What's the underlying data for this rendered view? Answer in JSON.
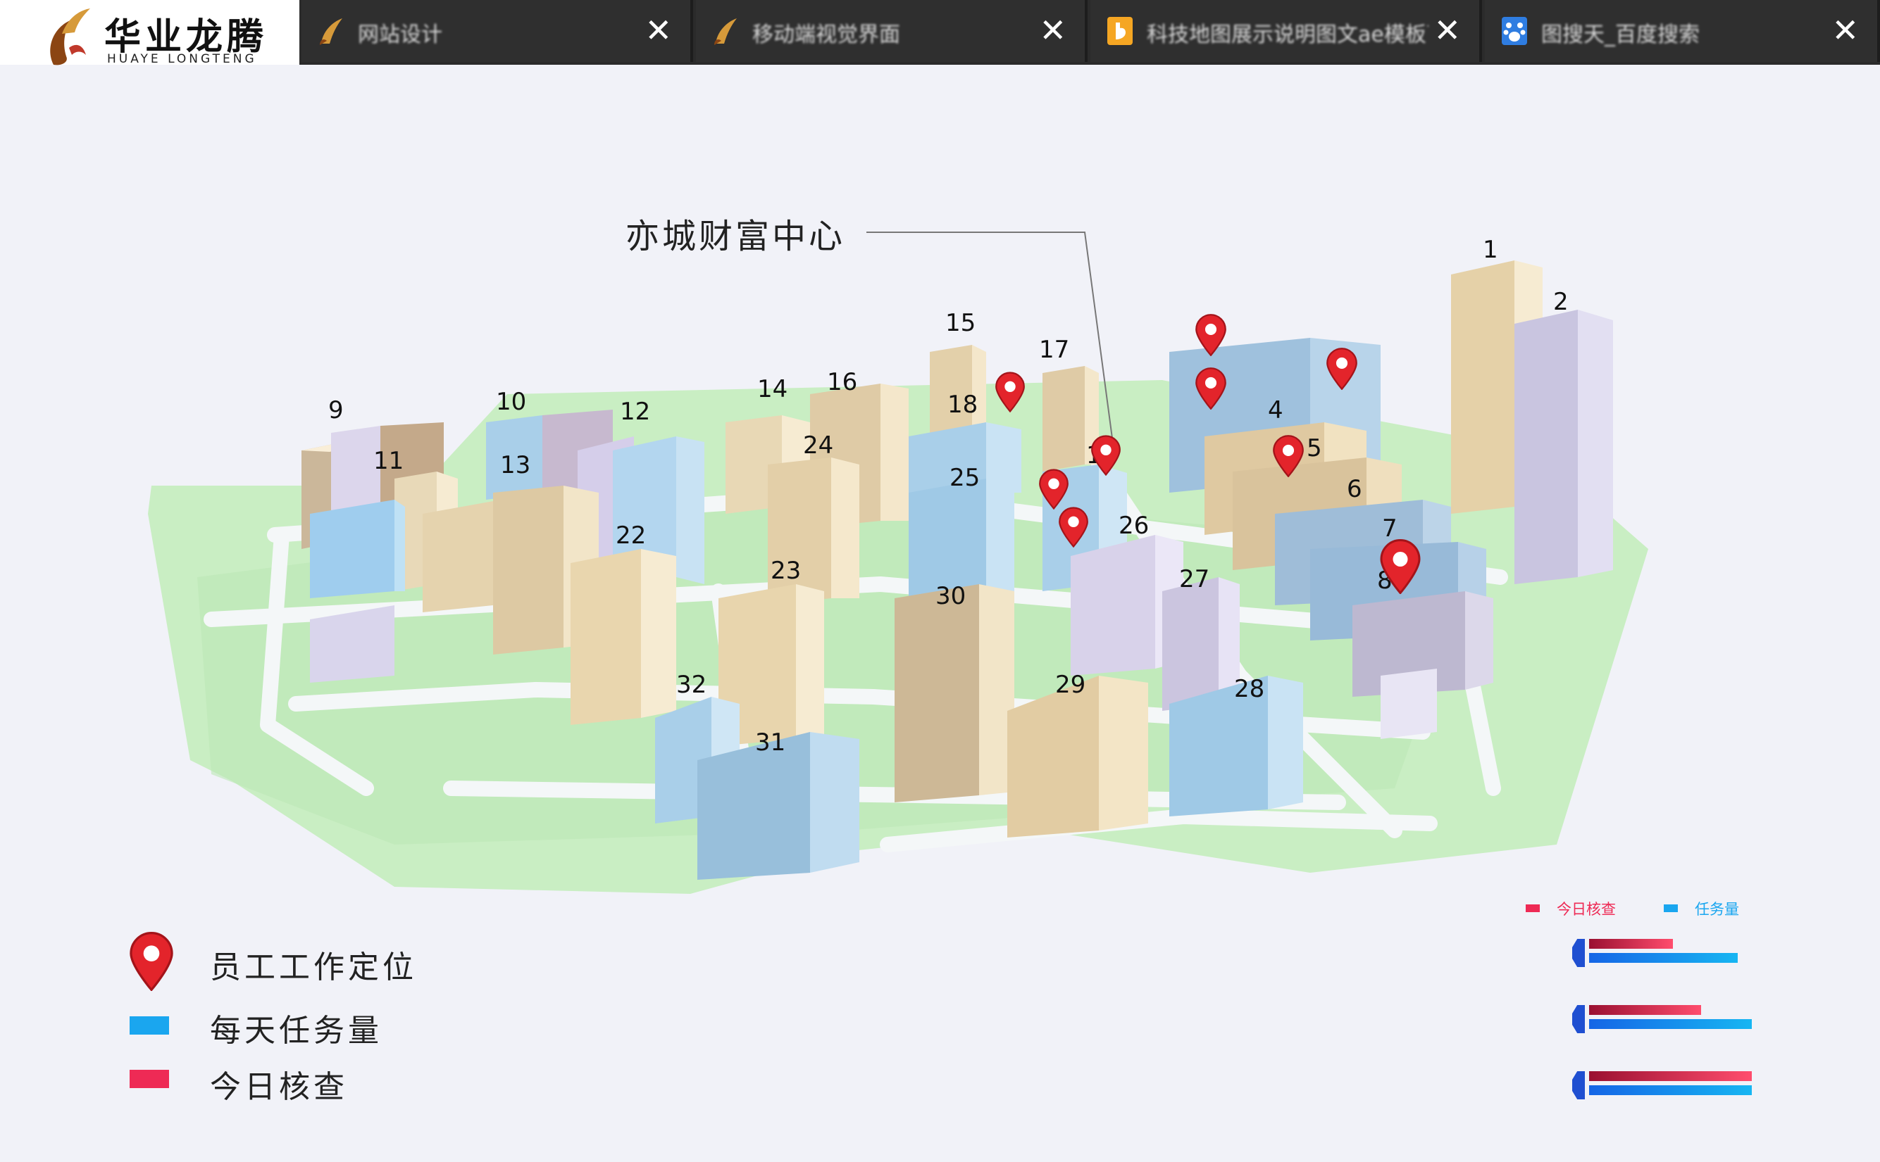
{
  "brand": {
    "name_cn": "华业龙腾",
    "name_en": "HUAYE LONGTENG"
  },
  "tabs": [
    {
      "title": "网站设计",
      "icon": "brush-icon"
    },
    {
      "title": "移动端视觉界面",
      "icon": "brush-icon"
    },
    {
      "title": "科技地图展示说明图文ae模板下载",
      "icon": "bookmark-icon"
    },
    {
      "title": "图搜天_百度搜索",
      "icon": "paw-icon"
    }
  ],
  "tab_close_label": "✕",
  "map": {
    "title": "亦城财富中心",
    "building_numbers": [
      "1",
      "2",
      "4",
      "5",
      "6",
      "7",
      "8",
      "9",
      "10",
      "11",
      "12",
      "13",
      "14",
      "15",
      "16",
      "17",
      "18",
      "19",
      "22",
      "23",
      "24",
      "25",
      "26",
      "27",
      "28",
      "29",
      "30",
      "31",
      "32"
    ]
  },
  "legend": {
    "items": [
      {
        "label": "员工工作定位",
        "icon": "location-pin-icon"
      },
      {
        "label": "每天任务量",
        "color": "#1aa6ef"
      },
      {
        "label": "今日核查",
        "color": "#ee2a55"
      }
    ]
  },
  "mini_chart": {
    "legend": [
      {
        "label": "今日核查",
        "color": "#ee2a55"
      },
      {
        "label": "任务量",
        "color": "#1aa6ef"
      }
    ],
    "rows": [
      {
        "check": 0.48,
        "task": 0.85
      },
      {
        "check": 0.64,
        "task": 0.93
      },
      {
        "check": 0.93,
        "task": 0.93
      }
    ]
  }
}
